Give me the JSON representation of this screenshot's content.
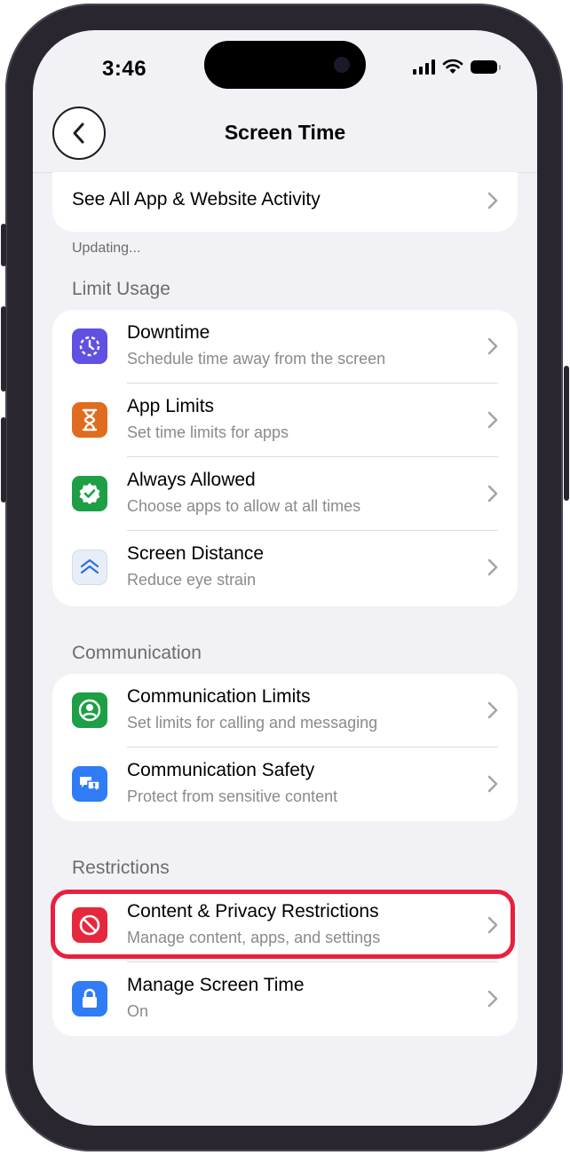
{
  "status_bar": {
    "time": "3:46"
  },
  "nav": {
    "title": "Screen Time"
  },
  "activity": {
    "label": "See All App & Website Activity",
    "note": "Updating..."
  },
  "sections": {
    "limit_usage": {
      "header": "Limit Usage",
      "items": [
        {
          "title": "Downtime",
          "subtitle": "Schedule time away from the screen",
          "icon": "downtime-icon",
          "color": "#6051e3"
        },
        {
          "title": "App Limits",
          "subtitle": "Set time limits for apps",
          "icon": "hourglass-icon",
          "color": "#e06d1f"
        },
        {
          "title": "Always Allowed",
          "subtitle": "Choose apps to allow at all times",
          "icon": "checkmark-badge-icon",
          "color": "#1e9e45"
        },
        {
          "title": "Screen Distance",
          "subtitle": "Reduce eye strain",
          "icon": "screen-distance-icon",
          "color": "#e8eef8"
        }
      ]
    },
    "communication": {
      "header": "Communication",
      "items": [
        {
          "title": "Communication Limits",
          "subtitle": "Set limits for calling and messaging",
          "icon": "person-circle-icon",
          "color": "#1e9e45"
        },
        {
          "title": "Communication Safety",
          "subtitle": "Protect from sensitive content",
          "icon": "chat-bubbles-icon",
          "color": "#2f7cf6"
        }
      ]
    },
    "restrictions": {
      "header": "Restrictions",
      "items": [
        {
          "title": "Content & Privacy Restrictions",
          "subtitle": "Manage content, apps, and settings",
          "icon": "prohibited-icon",
          "color": "#e5283e"
        },
        {
          "title": "Manage Screen Time",
          "subtitle": "On",
          "icon": "lock-icon",
          "color": "#2f7cf6"
        }
      ]
    }
  },
  "highlight_color": "#e8203f"
}
